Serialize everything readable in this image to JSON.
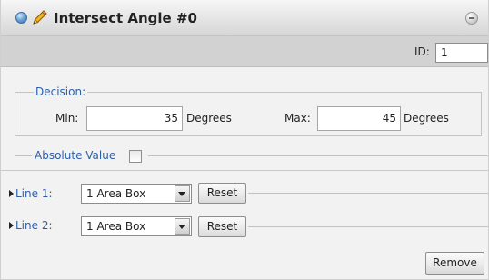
{
  "window": {
    "title": "Intersect Angle #0",
    "icons": [
      "status-dot-icon",
      "pencil-icon",
      "collapse-icon"
    ]
  },
  "id_field": {
    "label": "ID:",
    "value": "1"
  },
  "decision": {
    "legend": "Decision:",
    "min_label": "Min:",
    "min_value": "35",
    "min_unit": "Degrees",
    "max_label": "Max:",
    "max_value": "45",
    "max_unit": "Degrees"
  },
  "absolute_value": {
    "label": "Absolute Value",
    "checked": false
  },
  "lines": [
    {
      "label": "Line 1:",
      "selected": "1 Area Box",
      "reset_label": "Reset"
    },
    {
      "label": "Line 2:",
      "selected": "1 Area Box",
      "reset_label": "Reset"
    }
  ],
  "remove_label": "Remove",
  "colors": {
    "label_blue": "#2d5fa8",
    "panel_bg": "#f2f2f2",
    "id_bar_bg": "#d2d2d2"
  }
}
